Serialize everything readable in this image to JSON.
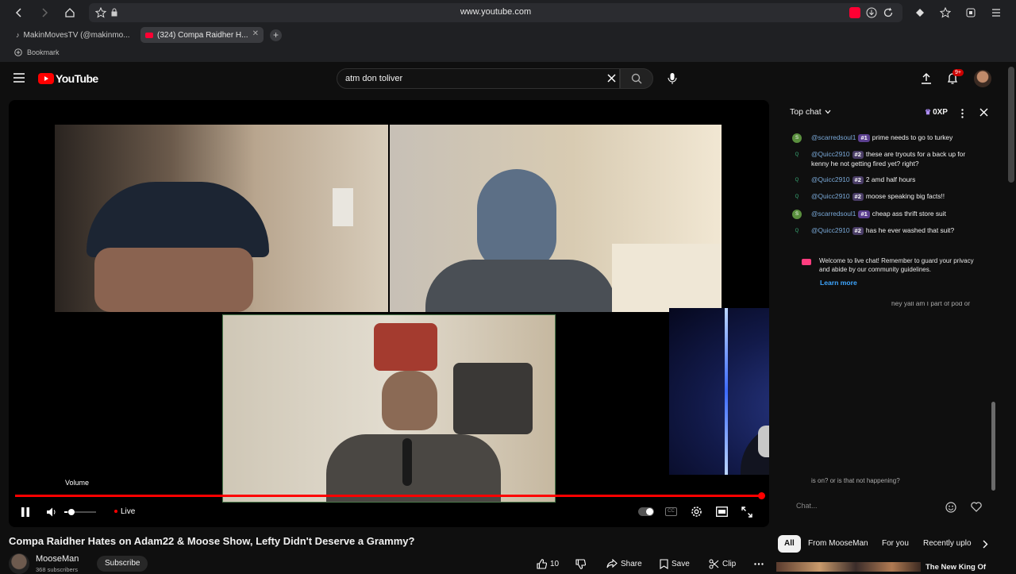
{
  "browser": {
    "url": "www.youtube.com",
    "tabs": [
      {
        "label": "MakinMovesTV (@makinmo..."
      },
      {
        "label": "(324) Compa Raidher H..."
      }
    ],
    "bookmark_label": "Bookmark"
  },
  "youtube": {
    "logo_text": "YouTube",
    "search_value": "atm don toliver",
    "notification_badge": "9+"
  },
  "player": {
    "volume_tooltip": "Volume",
    "live_label": "Live",
    "progress": 1.0,
    "volume_level": 0.1
  },
  "video": {
    "title": "Compa Raidher Hates on Adam22 & Moose Show, Lefty Didn't Deserve a Grammy?",
    "channel": "MooseMan",
    "subscribers": "368 subscribers",
    "subscribe_label": "Subscribe",
    "likes": "10",
    "share_label": "Share",
    "save_label": "Save",
    "clip_label": "Clip"
  },
  "chat": {
    "header": "Top chat",
    "xp": "0XP",
    "messages": [
      {
        "initial": "S",
        "author": "@scarredsoul1",
        "rank": "#1",
        "text": "prime needs to go to turkey",
        "color": "#5a8f3e"
      },
      {
        "initial": "Q",
        "author": "@Quicc2910",
        "rank": "#2",
        "text": "these are tryouts for a back up for kenny he not getting fired yet? right?",
        "color": "#0f0f0f"
      },
      {
        "initial": "Q",
        "author": "@Quicc2910",
        "rank": "#2",
        "text": "2 amd half hours",
        "color": "#0f0f0f"
      },
      {
        "initial": "Q",
        "author": "@Quicc2910",
        "rank": "#2",
        "text": "moose speaking big facts!!",
        "color": "#0f0f0f"
      },
      {
        "initial": "S",
        "author": "@scarredsoul1",
        "rank": "#1",
        "text": "cheap ass thrift store suit",
        "color": "#5a8f3e"
      },
      {
        "initial": "Q",
        "author": "@Quicc2910",
        "rank": "#2",
        "text": "has he ever washed that suit?",
        "color": "#0f0f0f"
      }
    ],
    "welcome_text": "Welcome to live chat! Remember to guard your privacy and abide by our community guidelines.",
    "learn_more": "Learn more",
    "partial_top": "hey yall am I part of pod or",
    "partial_bottom": "is on? or is that not happening?",
    "input_placeholder": "Chat..."
  },
  "chips": [
    "All",
    "From MooseMan",
    "For you",
    "Recently uplo"
  ],
  "recommended_title": "The New King Of",
  "colors": {
    "accent": "#ff0000",
    "link": "#3ea6ff",
    "background": "#0f0f0f"
  }
}
